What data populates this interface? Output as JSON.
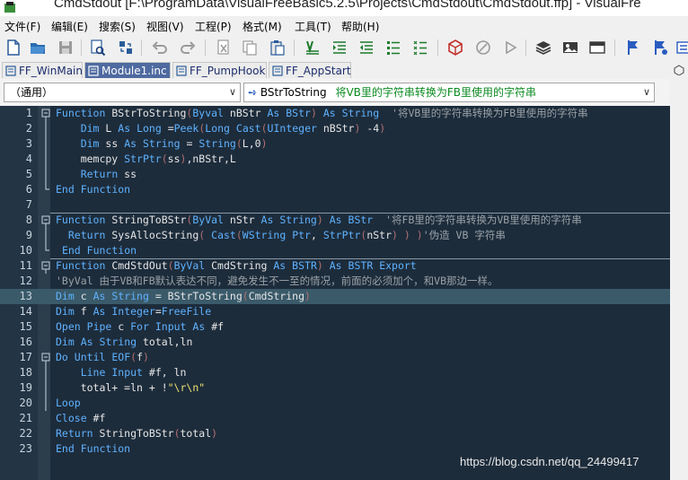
{
  "window": {
    "title": "CmdStdout [F:\\ProgramData\\VisualFreeBasic5.2.5\\Projects\\CmdStdout\\CmdStdout.ffp] - VisualFre"
  },
  "menu": [
    "文件(F)",
    "编辑(E)",
    "搜索(S)",
    "视图(V)",
    "工程(P)",
    "格式(M)",
    "工具(T)",
    "帮助(H)"
  ],
  "toolbar_icons": [
    "new-file-icon",
    "open-folder-icon",
    "save-icon",
    "find-icon",
    "replace-icon",
    "undo-icon",
    "redo-icon",
    "cut-icon",
    "copy-icon",
    "paste-icon",
    "align-icon",
    "indent-icon",
    "outdent-icon",
    "list-icon",
    "list-numbered-icon",
    "cube-icon",
    "stop-icon",
    "run-icon",
    "layers-icon",
    "image-icon",
    "table-icon",
    "flag-icon",
    "flag-run-icon",
    "settings-icon"
  ],
  "tabs": [
    {
      "label": "FF_WinMain",
      "active": false
    },
    {
      "label": "Module1.inc",
      "active": true
    },
    {
      "label": "FF_PumpHook",
      "active": false
    },
    {
      "label": "FF_AppStart",
      "active": false
    }
  ],
  "combo_left": "（通用）",
  "combo_right": {
    "func": "BStrToString",
    "desc": "将VB里的字符串转换为FB里使用的字符串"
  },
  "code_lines": [
    {
      "n": "1",
      "t": "Function BStrToString(Byval nBStr As BStr) As String  '将VB里的字符串转换为FB里使用的字符串"
    },
    {
      "n": "2",
      "t": "    Dim L As Long =Peek(Long Cast(UInteger nBStr) -4)"
    },
    {
      "n": "3",
      "t": "    Dim ss As String = String(L,0)"
    },
    {
      "n": "4",
      "t": "    memcpy StrPtr(ss),nBStr,L"
    },
    {
      "n": "5",
      "t": "    Return ss"
    },
    {
      "n": "6",
      "t": "End Function"
    },
    {
      "n": "7",
      "t": ""
    },
    {
      "n": "8",
      "t": "Function StringToBStr(ByVal nStr As String) As BStr  '将FB里的字符串转换为VB里使用的字符串"
    },
    {
      "n": "9",
      "t": "  Return SysAllocString( Cast(WString Ptr, StrPtr(nStr) ) )'伪造 VB 字符串"
    },
    {
      "n": "10",
      "t": " End Function"
    },
    {
      "n": "11",
      "t": "Function CmdStdOut(ByVal CmdString As BSTR) As BSTR Export"
    },
    {
      "n": "12",
      "t": "'ByVal 由于VB和FB默认表达不同，避免发生不一至的情况，前面的必须加个，和VB那边一样。"
    },
    {
      "n": "13",
      "t": "Dim c As String = BStrToString(CmdString)"
    },
    {
      "n": "14",
      "t": "Dim f As Integer=FreeFile"
    },
    {
      "n": "15",
      "t": "Open Pipe c For Input As #f"
    },
    {
      "n": "16",
      "t": "Dim As String total,ln"
    },
    {
      "n": "17",
      "t": "Do Until EOF(f)"
    },
    {
      "n": "18",
      "t": "    Line Input #f, ln"
    },
    {
      "n": "19",
      "t": "    total+ =ln + !\"\\r\\n\""
    },
    {
      "n": "20",
      "t": "Loop"
    },
    {
      "n": "21",
      "t": "Close #f"
    },
    {
      "n": "22",
      "t": "Return StringToBStr(total)"
    },
    {
      "n": "23",
      "t": "End Function"
    }
  ],
  "highlighted_line": "13",
  "watermark": "https://blog.csdn.net/qq_24499417",
  "colors": {
    "editor_bg": "#1d2c3b",
    "keyword": "#5fb2ff",
    "comment": "#9aa2a8",
    "active_tab": "#4e6aa0"
  }
}
